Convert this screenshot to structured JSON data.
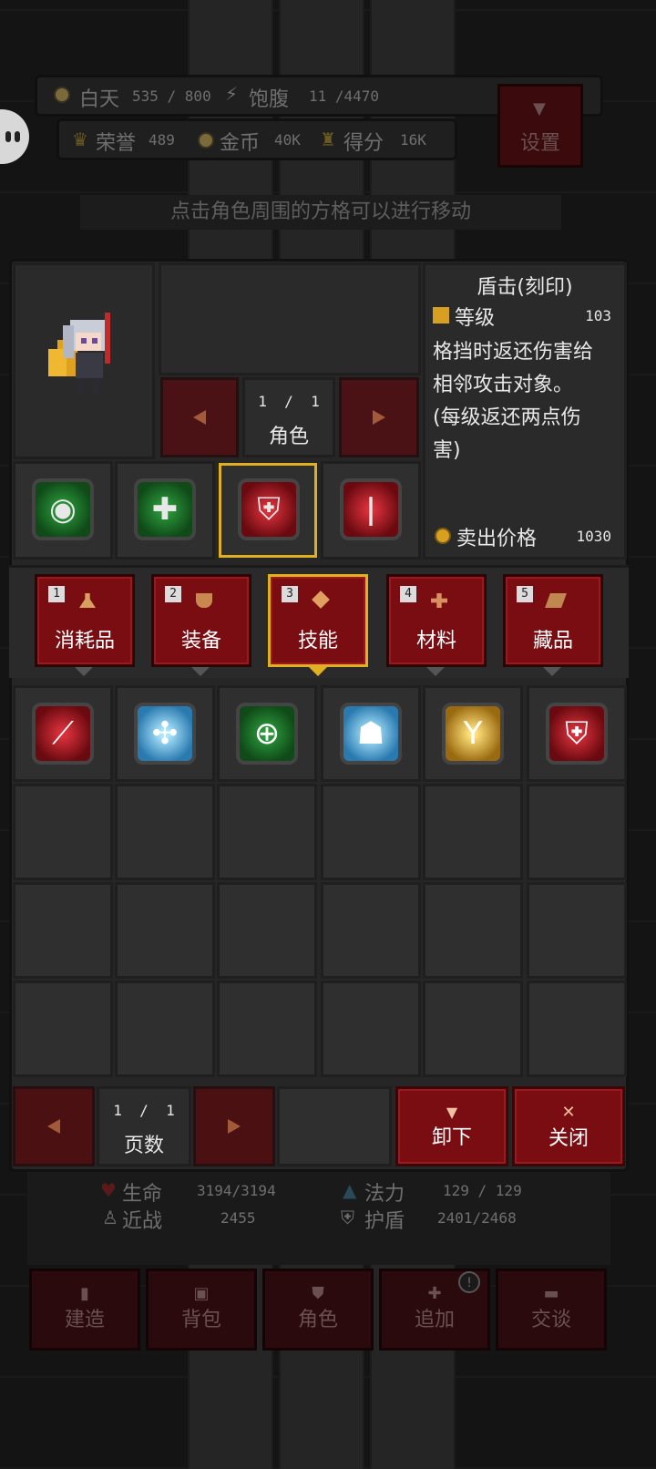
{
  "hud": {
    "day_label": "白天",
    "day_value": "535 / 800",
    "hunger_label": "饱腹",
    "hunger_value": "11 /4470",
    "honor_label": "荣誉",
    "honor_value": "489",
    "gold_label": "金币",
    "gold_value": "40K",
    "score_label": "得分",
    "score_value": "16K",
    "settings_label": "设置",
    "hint": "点击角色周围的方格可以进行移动"
  },
  "character": {
    "page": "1  /  1",
    "label": "角色"
  },
  "skill_detail": {
    "title": "盾击(刻印)",
    "level_label": "等级",
    "level_value": "103",
    "desc_lines": [
      "格挡时返还伤害给",
      "相邻攻击对象。",
      "(每级返还两点伤",
      "害)"
    ],
    "sell_label": "卖出价格",
    "sell_value": "1030"
  },
  "equipped_slots": [
    {
      "icon": "eye-skill-icon",
      "color": "green"
    },
    {
      "icon": "cross-skill-icon",
      "color": "green"
    },
    {
      "icon": "shield-bash-icon",
      "color": "red",
      "selected": true
    },
    {
      "icon": "blade-skill-icon",
      "color": "red"
    }
  ],
  "tabs": [
    {
      "num": "1",
      "label": "消耗品",
      "icon": "potion-icon"
    },
    {
      "num": "2",
      "label": "装备",
      "icon": "armor-icon"
    },
    {
      "num": "3",
      "label": "技能",
      "icon": "skill-diamond-icon",
      "selected": true
    },
    {
      "num": "4",
      "label": "材料",
      "icon": "material-icon"
    },
    {
      "num": "5",
      "label": "藏品",
      "icon": "collectible-icon"
    }
  ],
  "inventory": [
    {
      "icon": "sword-slash-icon",
      "color": "red"
    },
    {
      "icon": "ice-cross-icon",
      "color": "blue"
    },
    {
      "icon": "nature-ring-icon",
      "color": "green"
    },
    {
      "icon": "ice-spirit-icon",
      "color": "blue"
    },
    {
      "icon": "holy-light-icon",
      "color": "gold"
    },
    {
      "icon": "shield-cross-icon",
      "color": "red"
    }
  ],
  "pager": {
    "page": "1  /  1",
    "label": "页数"
  },
  "actions": {
    "unequip": "卸下",
    "close": "关闭"
  },
  "stats": {
    "hp_label": "生命",
    "hp_value": "3194/3194",
    "mp_label": "法力",
    "mp_value": "129 / 129",
    "melee_label": "近战",
    "melee_value": "2455",
    "shield_label": "护盾",
    "shield_value": "2401/2468"
  },
  "nav": [
    "建造",
    "背包",
    "角色",
    "追加",
    "交谈"
  ]
}
